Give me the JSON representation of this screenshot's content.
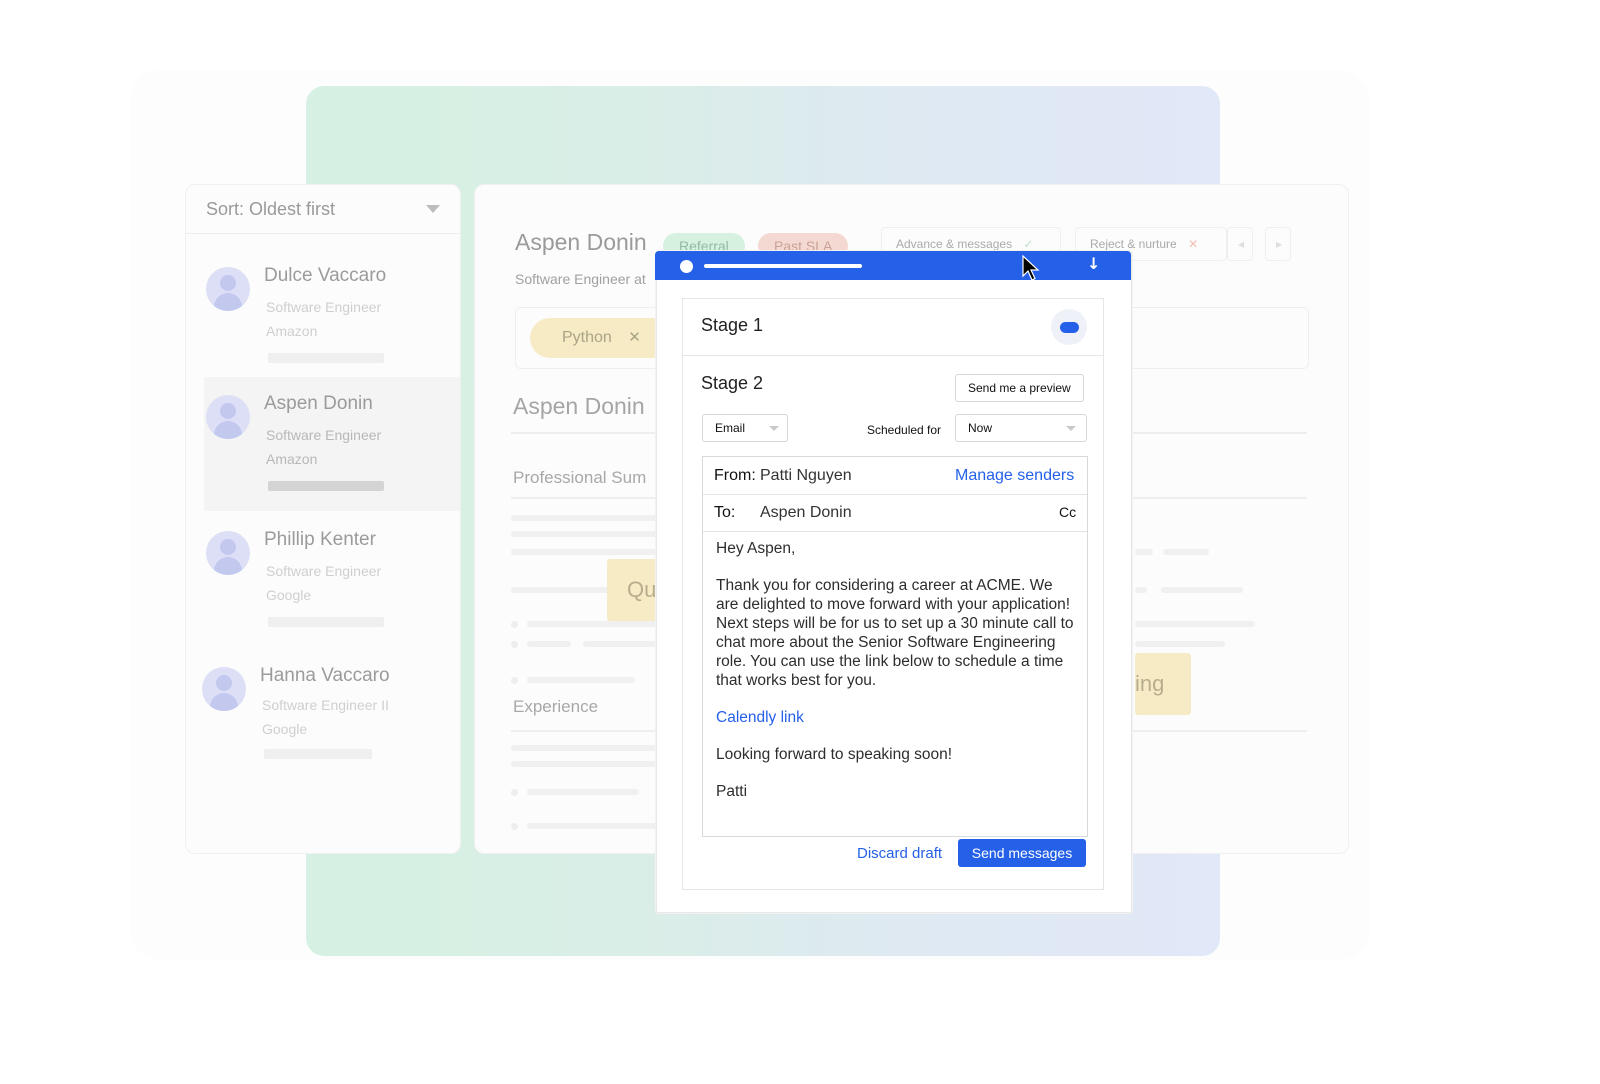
{
  "sort": {
    "label": "Sort: Oldest first"
  },
  "candidates": [
    {
      "name": "Dulce Vaccaro",
      "title": "Software Engineer",
      "company": "Amazon"
    },
    {
      "name": "Aspen Donin",
      "title": "Software Engineer",
      "company": "Amazon"
    },
    {
      "name": "Phillip Kenter",
      "title": "Software Engineer",
      "company": "Google"
    },
    {
      "name": "Hanna Vaccaro",
      "title": "Software Engineer II",
      "company": "Google"
    }
  ],
  "profile": {
    "name": "Aspen Donin",
    "role": "Software Engineer at",
    "badges": {
      "referral": "Referral",
      "sla": "Past SLA"
    },
    "actions": {
      "advance": "Advance & messages",
      "reject": "Reject & nurture"
    },
    "skill": "Python",
    "section_name": "Aspen Donin",
    "section_summary": "Professional Sum",
    "section_experience": "Experience",
    "sticky_left": "Qu",
    "sticky_right": "ing"
  },
  "modal": {
    "stage1_title": "Stage 1",
    "stage2_title": "Stage 2",
    "preview_button": "Send me a preview",
    "channel": "Email",
    "scheduled_label": "Scheduled for",
    "scheduled_value": "Now",
    "from_label": "From:",
    "from_value": "Patti Nguyen",
    "manage_senders": "Manage senders",
    "to_label": "To:",
    "to_value": "Aspen Donin",
    "cc_label": "Cc",
    "greeting": "Hey Aspen,",
    "body": "Thank you for considering a career at ACME. We are delighted to move forward with your application! Next steps will be for us to set up a 30 minute call to chat more about the Senior Software Engineering role. You can use the link below to schedule a time that works best for you.",
    "link_text": "Calendly link",
    "closing": "Looking forward to speaking soon!",
    "signature": "Patti",
    "discard": "Discard draft",
    "send": "Send messages"
  },
  "colors": {
    "accent": "#2460e8",
    "gradient_start": "#d6f1e3",
    "gradient_end": "#e1e8f8"
  }
}
